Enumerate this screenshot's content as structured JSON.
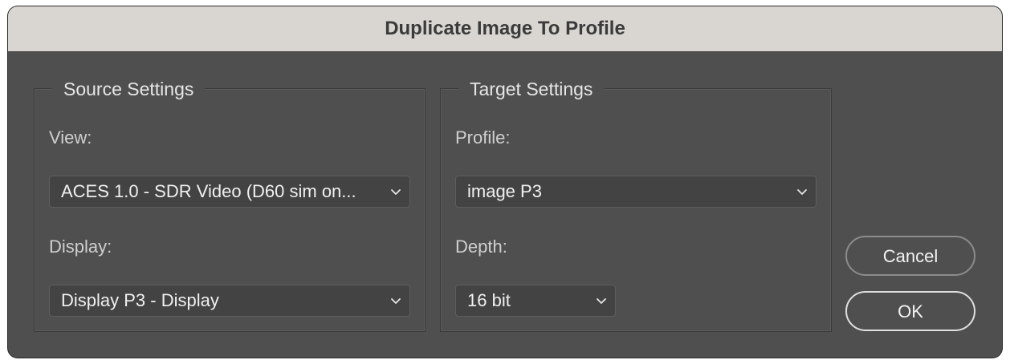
{
  "dialog": {
    "title": "Duplicate Image To Profile"
  },
  "source": {
    "legend": "Source Settings",
    "view_label": "View:",
    "view_value": "ACES 1.0 - SDR Video (D60 sim on...",
    "display_label": "Display:",
    "display_value": "Display P3 - Display"
  },
  "target": {
    "legend": "Target Settings",
    "profile_label": "Profile:",
    "profile_value": "image P3",
    "depth_label": "Depth:",
    "depth_value": "16 bit"
  },
  "buttons": {
    "cancel": "Cancel",
    "ok": "OK"
  },
  "icons": {
    "dropdown": "chevron-down-icon"
  },
  "colors": {
    "titlebar": "#d9d6d1",
    "dialog_bg": "#4f4f4f",
    "field_bg": "#434343",
    "default_button_border": "#e0e0e0"
  }
}
